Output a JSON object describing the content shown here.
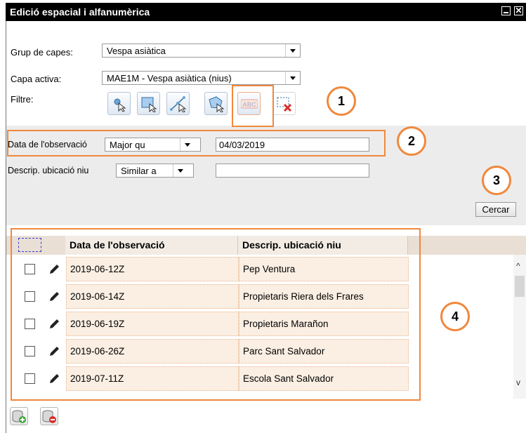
{
  "window": {
    "title": "Edició espacial i alfanumèrica"
  },
  "form": {
    "group_label": "Grup de capes:",
    "group_value": "Vespa asiàtica",
    "layer_label": "Capa activa:",
    "layer_value": "MAE1M - Vespa asiàtica (nius)",
    "filter_label": "Filtre:"
  },
  "toolbar": {
    "icons": [
      "point-select-icon",
      "rectangle-select-icon",
      "line-select-icon",
      "polygon-select-icon",
      "text-filter-icon",
      "clear-selection-icon"
    ],
    "abc_text": "ABC"
  },
  "filters": [
    {
      "field": "Data de l'observació",
      "operator": "Major qu",
      "value": "04/03/2019"
    },
    {
      "field": "Descrip. ubicació niu",
      "operator": "Similar a",
      "value": ""
    }
  ],
  "search_button": "Cercar",
  "table": {
    "columns": [
      "Data de l'observació",
      "Descrip. ubicació niu"
    ],
    "rows": [
      {
        "date": "2019-06-12Z",
        "location": "Pep Ventura"
      },
      {
        "date": "2019-06-14Z",
        "location": "Propietaris Riera dels Frares"
      },
      {
        "date": "2019-06-19Z",
        "location": "Propietaris Marañon"
      },
      {
        "date": "2019-06-26Z",
        "location": "Parc Sant Salvador"
      },
      {
        "date": "2019-07-11Z",
        "location": "Escola Sant Salvador"
      }
    ]
  },
  "annotations": [
    "1",
    "2",
    "3",
    "4"
  ],
  "colors": {
    "annotation": "#f0883c",
    "titlebar": "#000000",
    "row_bg": "#fbefe3"
  }
}
